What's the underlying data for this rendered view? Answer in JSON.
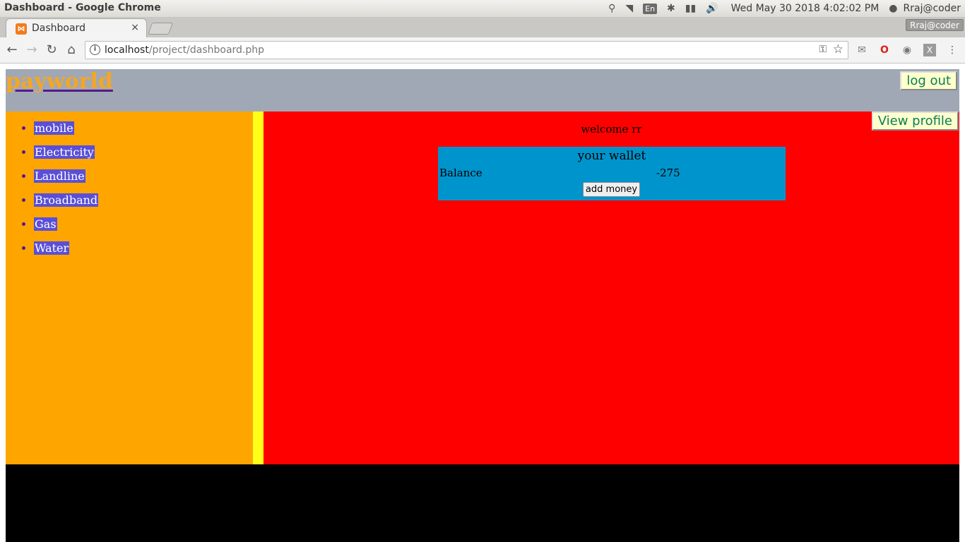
{
  "os": {
    "window_title": "Dashboard - Google Chrome",
    "lang": "En",
    "clock": "Wed May 30 2018  4:02:02 PM",
    "user": "Rraj@coder"
  },
  "browser": {
    "tab_title": "Dashboard",
    "tab_close": "×",
    "profile_chip": "Rraj@coder",
    "url_host": "localhost",
    "url_path": "/project/dashboard.php"
  },
  "site": {
    "logo": "payworld",
    "logout_label": "log out",
    "view_profile_label": "View profile"
  },
  "sidebar": {
    "items": [
      {
        "label": "mobile"
      },
      {
        "label": "Electricity"
      },
      {
        "label": "Landline"
      },
      {
        "label": "Broadband"
      },
      {
        "label": "Gas"
      },
      {
        "label": "Water"
      }
    ]
  },
  "main": {
    "welcome": "welcome rr",
    "wallet": {
      "title": "your wallet",
      "balance_label": "Balance",
      "balance_value": "-275",
      "add_money_label": "add money"
    }
  },
  "colors": {
    "header_bg": "#a0a8b5",
    "sidebar_bg": "#ffa500",
    "divider_bg": "#ffff1a",
    "main_bg": "#ff0000",
    "wallet_bg": "#0094cc",
    "footer_bg": "#000000"
  }
}
